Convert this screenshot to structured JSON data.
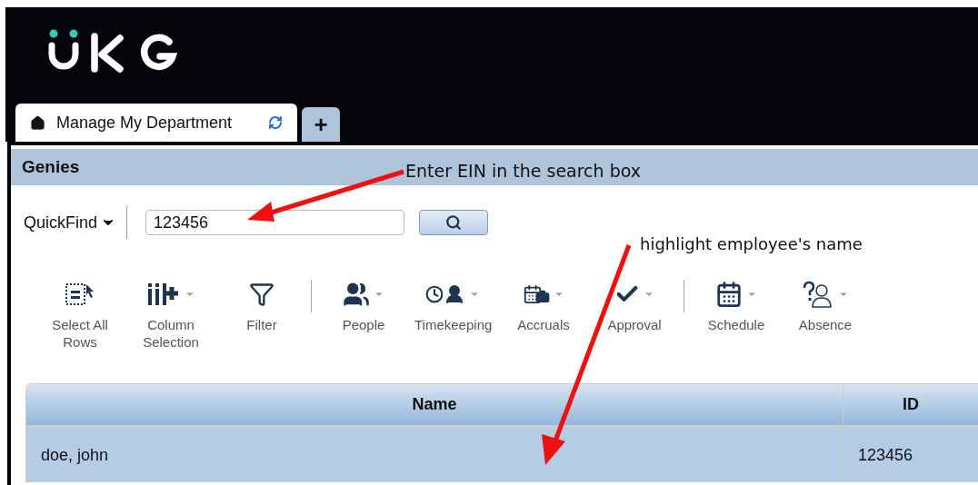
{
  "tabs": [
    {
      "label": "Manage My Department",
      "selected": true
    },
    {
      "label": "+",
      "selected": false
    }
  ],
  "panel": {
    "title": "Genies"
  },
  "quickfind": {
    "label": "QuickFind",
    "value": "123456"
  },
  "toolbar": [
    {
      "label": "Select All Rows",
      "dropdown": false,
      "separator_before": false
    },
    {
      "label": "Column Selection",
      "dropdown": true,
      "separator_before": false
    },
    {
      "label": "Filter",
      "dropdown": false,
      "separator_before": false
    },
    {
      "label": "People",
      "dropdown": true,
      "separator_before": true
    },
    {
      "label": "Timekeeping",
      "dropdown": true,
      "separator_before": false
    },
    {
      "label": "Accruals",
      "dropdown": true,
      "separator_before": false
    },
    {
      "label": "Approval",
      "dropdown": true,
      "separator_before": false
    },
    {
      "label": "Schedule",
      "dropdown": true,
      "separator_before": true
    },
    {
      "label": "Absence",
      "dropdown": true,
      "separator_before": false
    }
  ],
  "table": {
    "columns": [
      "Name",
      "ID"
    ],
    "rows": [
      {
        "cells": [
          "doe, john",
          "123456"
        ],
        "selected": true
      }
    ]
  },
  "annotations": [
    "Enter EIN in the search box",
    "highlight employee's name"
  ]
}
